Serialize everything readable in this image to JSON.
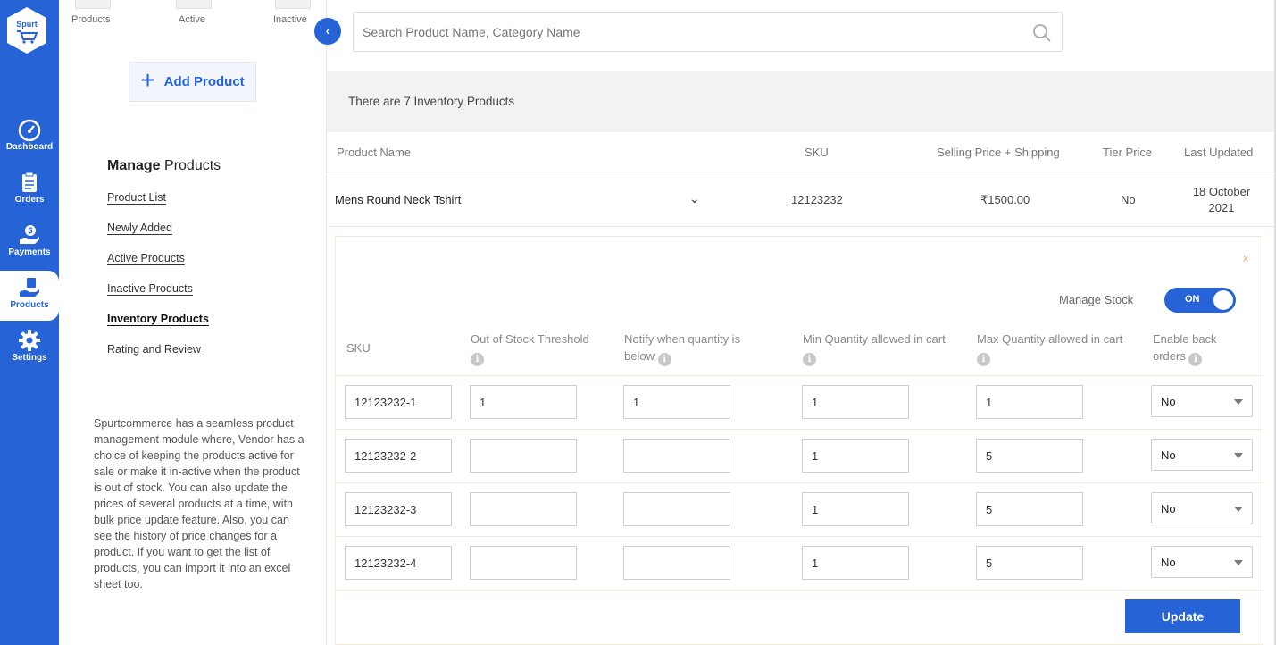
{
  "rail": {
    "logo_text": "Spurt",
    "items": [
      {
        "label": "Dashboard",
        "icon": "gauge-icon"
      },
      {
        "label": "Orders",
        "icon": "clipboard-icon"
      },
      {
        "label": "Payments",
        "icon": "payment-hand-icon"
      },
      {
        "label": "Products",
        "icon": "product-hand-icon",
        "active": true
      },
      {
        "label": "Settings",
        "icon": "gear-icon"
      }
    ]
  },
  "sidebar": {
    "stats": [
      "Products",
      "Active",
      "Inactive"
    ],
    "add_product_label": "Add Product",
    "manage_title_bold": "Manage",
    "manage_title_rest": "Products",
    "links": [
      "Product List",
      "Newly Added",
      "Active Products",
      "Inactive Products",
      "Inventory Products",
      "Rating and Review"
    ],
    "active_link": "Inventory Products",
    "description": "Spurtcommerce has a seamless product management module where, Vendor has a choice of keeping the products active for sale or make it in-active when the product is out of stock. You can also update the prices of several products at a time, with bulk price update feature. Also, you can see the history of price changes for a product. If you want to get the list of products, you can import it into an excel sheet too."
  },
  "search": {
    "placeholder": "Search Product Name, Category Name"
  },
  "banner": {
    "text": "There are 7 Inventory Products"
  },
  "table": {
    "headers": [
      "Product Name",
      "SKU",
      "Selling Price + Shipping",
      "Tier Price",
      "Last Updated"
    ],
    "row": {
      "name": "Mens Round Neck Tshirt",
      "sku": "12123232",
      "price": "₹1500.00",
      "tier": "No",
      "updated_line1": "18 October",
      "updated_line2": "2021"
    }
  },
  "inventory": {
    "close_label": "x",
    "manage_stock_label": "Manage Stock",
    "toggle_label": "ON",
    "headers": {
      "sku": "SKU",
      "threshold": "Out of Stock Threshold",
      "notify": "Notify when quantity is below",
      "min": "Min Quantity allowed in cart",
      "max": "Max Quantity allowed in cart",
      "back": "Enable back orders"
    },
    "rows": [
      {
        "sku": "12123232-1",
        "threshold": "1",
        "notify": "1",
        "min": "1",
        "max": "1",
        "back": "No"
      },
      {
        "sku": "12123232-2",
        "threshold": "",
        "notify": "",
        "min": "1",
        "max": "5",
        "back": "No"
      },
      {
        "sku": "12123232-3",
        "threshold": "",
        "notify": "",
        "min": "1",
        "max": "5",
        "back": "No"
      },
      {
        "sku": "12123232-4",
        "threshold": "",
        "notify": "",
        "min": "1",
        "max": "5",
        "back": "No"
      }
    ],
    "update_label": "Update"
  },
  "colors": {
    "accent": "#2563d6",
    "banner_bg": "#f2f2f2"
  }
}
